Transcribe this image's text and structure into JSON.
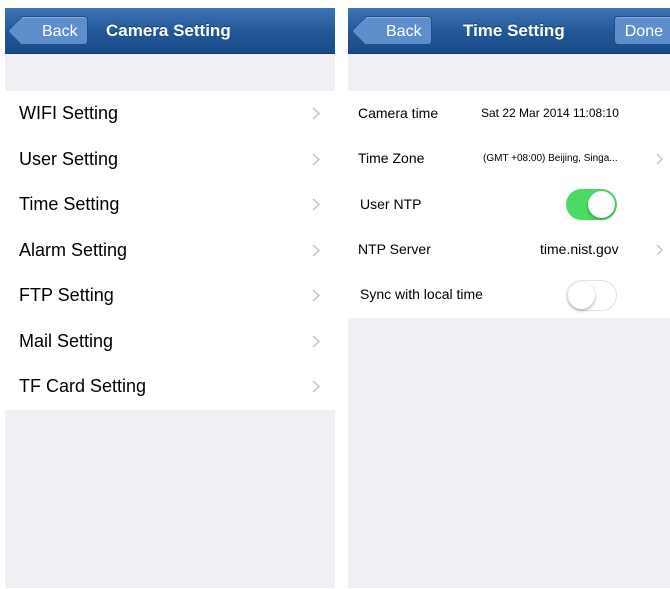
{
  "colors": {
    "navbar": "#225797",
    "back_button": "#5e8fcc",
    "background": "#efeff4",
    "toggle_on": "#4cd964",
    "chevron": "#c7c7cc"
  },
  "left": {
    "back_label": "Back",
    "title": "Camera Setting",
    "items": [
      {
        "label": "WIFI Setting",
        "icon": "chevron-right-icon"
      },
      {
        "label": "User Setting",
        "icon": "chevron-right-icon"
      },
      {
        "label": "Time Setting",
        "icon": "chevron-right-icon"
      },
      {
        "label": "Alarm Setting",
        "icon": "chevron-right-icon"
      },
      {
        "label": "FTP Setting",
        "icon": "chevron-right-icon"
      },
      {
        "label": "Mail Setting",
        "icon": "chevron-right-icon"
      },
      {
        "label": "TF Card Setting",
        "icon": "chevron-right-icon"
      }
    ]
  },
  "right": {
    "back_label": "Back",
    "title": "Time Setting",
    "done_label": "Done",
    "camera_time": {
      "label": "Camera time",
      "value": "Sat 22 Mar 2014  11:08:10"
    },
    "time_zone": {
      "label": "Time Zone",
      "value": "(GMT +08:00) Beijing, Singa..."
    },
    "user_ntp": {
      "label": "User NTP",
      "enabled": true
    },
    "ntp_server": {
      "label": "NTP Server",
      "value": "time.nist.gov"
    },
    "sync_local": {
      "label": "Sync with local time",
      "enabled": false
    }
  }
}
